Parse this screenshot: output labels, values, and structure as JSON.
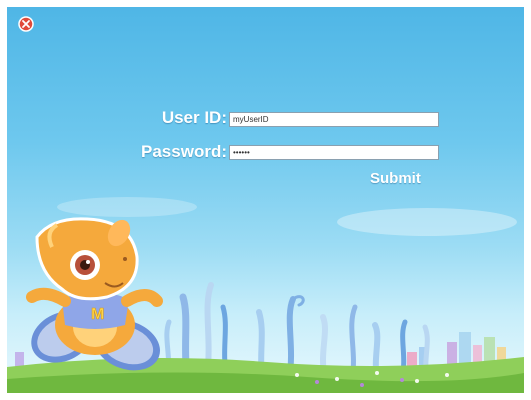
{
  "window": {
    "close_icon": "close-icon",
    "close_color": "#e04a3a"
  },
  "login": {
    "user_label": "User ID:",
    "user_value": "myUserID",
    "password_label": "Password:",
    "password_value": "••••••",
    "submit_label": "Submit"
  },
  "colors": {
    "sky_top": "#4fb6e6",
    "sky_bottom": "#e8f8fd",
    "grass": "#7cc24a",
    "mascot": "#f5a93c"
  },
  "mascot": {
    "shirt_letter": "M"
  }
}
